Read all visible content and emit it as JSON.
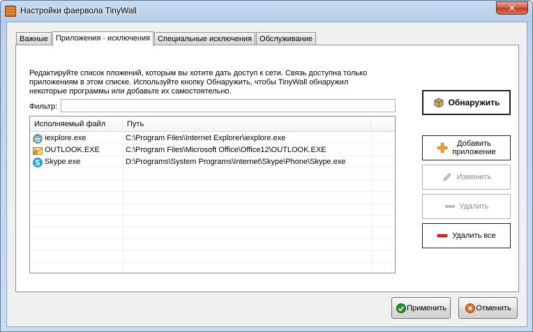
{
  "window": {
    "title": "Настройки фаервола TinyWall",
    "close_label": "✕"
  },
  "tabs": [
    {
      "label": "Важные",
      "active": false
    },
    {
      "label": "Приложения - исключения",
      "active": true
    },
    {
      "label": "Специальные исключения",
      "active": false
    },
    {
      "label": "Обслуживание",
      "active": false
    }
  ],
  "panel": {
    "description": "Редактируйте список пложений, которым вы хотите дать доступ к сети. Связь доступна только приложениям в этом списке. Используйте кнопку Обнаружить, чтобы TinyWall обнаружил некоторые программы или добавьте их самостоятельно.",
    "filter_label": "Фильтр:",
    "filter_value": "",
    "columns": {
      "file": "Исполняемый файл",
      "path": "Путь"
    },
    "rows": [
      {
        "file": "iexplore.exe",
        "path": "C:\\Program Files\\Internet Explorer\\iexplore.exe",
        "icon": "internet-explorer-icon"
      },
      {
        "file": "OUTLOOK.EXE",
        "path": "C:\\Program Files\\Microsoft Office\\Office12\\OUTLOOK.EXE",
        "icon": "outlook-icon"
      },
      {
        "file": "Skype.exe",
        "path": "D:\\Programs\\System Programs\\Internet\\Skype\\Phone\\Skype.exe",
        "icon": "skype-icon"
      }
    ]
  },
  "side_buttons": {
    "detect": "Обнаружить",
    "add_line1": "Добавить",
    "add_line2": "приложение",
    "edit": "Изменить",
    "remove": "Удалить",
    "remove_all": "Удалить все"
  },
  "bottom_buttons": {
    "apply": "Применить",
    "cancel": "Отменить"
  },
  "colors": {
    "add_icon": "#f0a030",
    "remove_all_icon": "#e02020",
    "apply_icon": "#2e8b2e",
    "cancel_icon": "#e07020"
  }
}
